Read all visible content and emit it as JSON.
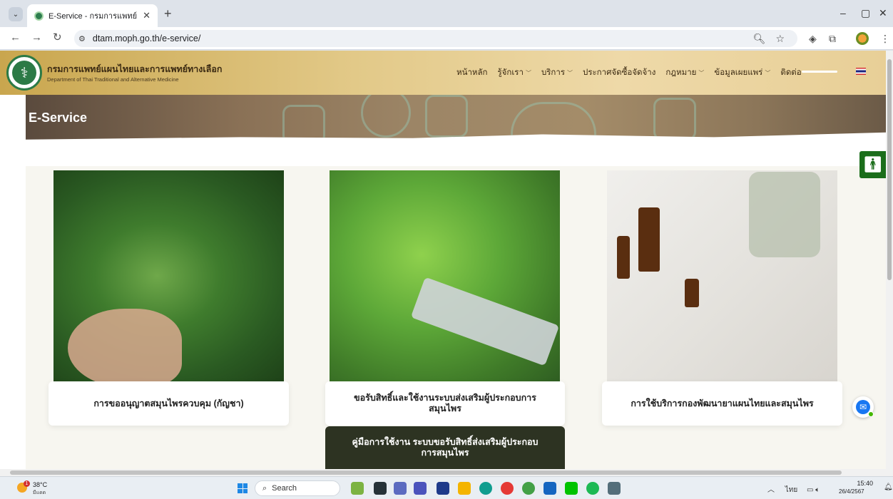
{
  "browser": {
    "tab_title": "E-Service - กรมการแพทย์แผนไทยและ",
    "new_tab": "+",
    "url": "dtam.moph.go.th/e-service/",
    "window_controls": [
      "–",
      "▢",
      "✕"
    ]
  },
  "site": {
    "org_name_th": "กรมการแพทย์แผนไทยและการแพทย์ทางเลือก",
    "org_name_en": "Department of Thai Traditional and Alternative Medicine",
    "nav": [
      {
        "label": "หน้าหลัก",
        "dropdown": false
      },
      {
        "label": "รู้จักเรา",
        "dropdown": true
      },
      {
        "label": "บริการ",
        "dropdown": true
      },
      {
        "label": "ประกาศจัดซื้อจัดจ้าง",
        "dropdown": false
      },
      {
        "label": "กฎหมาย",
        "dropdown": true
      },
      {
        "label": "ข้อมูลเผยแพร่",
        "dropdown": true
      },
      {
        "label": "ติดต่อ",
        "dropdown": false
      }
    ],
    "page_title": "E-Service"
  },
  "cards": [
    {
      "title": "การขออนุญาตสมุนไพรควบคุม (กัญชา)"
    },
    {
      "title": "ขอรับสิทธิ์และใช้งานระบบส่งเสริมผู้ประกอบการสมุนไพร"
    },
    {
      "title": "การใช้บริการกองพัฒนายาแผนไทยและสมุนไพร"
    }
  ],
  "manual_button": "คู่มือการใช้งาน ระบบขอรับสิทธิ์ส่งเสริมผู้ประกอบการสมุนไพร",
  "taskbar": {
    "weather_temp": "38°C",
    "weather_desc": "มีแดด",
    "weather_badge": "1",
    "search_label": "Search",
    "tray_lang": "ไทย",
    "time": "15:40",
    "date": "26/4/2567"
  },
  "colors": {
    "header_gold": "#e2c988",
    "accessibility_green": "#1b6e1b",
    "manual_button_bg": "#2d3322",
    "messenger_blue": "#1877f2"
  }
}
